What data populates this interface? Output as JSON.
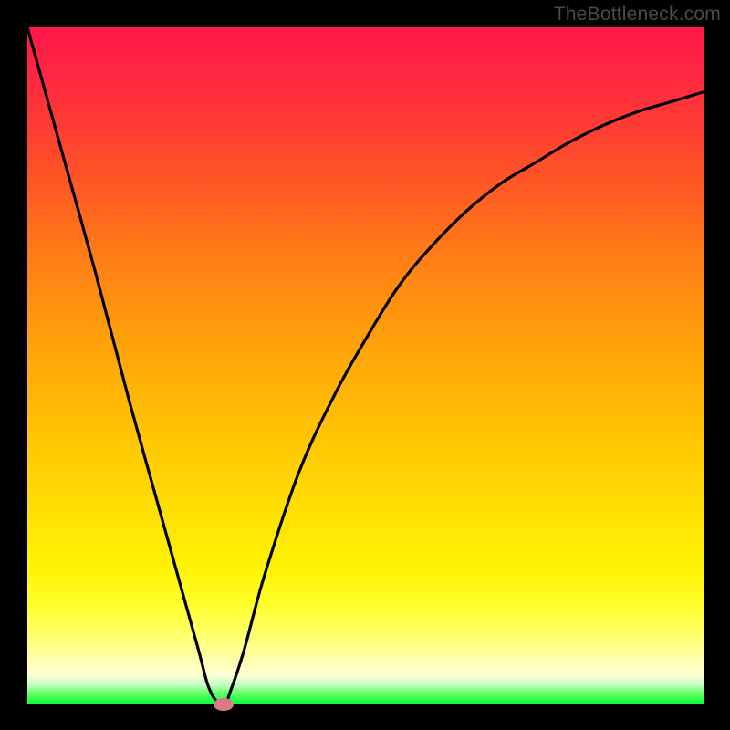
{
  "attribution": "TheBottleneck.com",
  "chart_data": {
    "type": "line",
    "title": "",
    "xlabel": "",
    "ylabel": "",
    "xlim": [
      0,
      100
    ],
    "ylim": [
      0,
      100
    ],
    "grid": false,
    "legend": false,
    "series": [
      {
        "name": "bottleneck-curve",
        "x": [
          0,
          5,
          10,
          15,
          20,
          25,
          27,
          29,
          30,
          32,
          35,
          40,
          45,
          50,
          55,
          60,
          65,
          70,
          75,
          80,
          85,
          90,
          95,
          100
        ],
        "y": [
          100,
          82,
          64,
          45,
          27,
          9,
          2,
          0,
          2,
          8,
          19,
          34,
          45,
          54,
          62,
          68,
          73,
          77,
          80,
          83,
          85.5,
          87.5,
          89,
          90.5
        ]
      }
    ],
    "marker": {
      "x": 29,
      "y": 0
    },
    "background_gradient": {
      "top_color": "#ff174a",
      "mid_color": "#ffff28",
      "bottom_color": "#00ff3a"
    }
  }
}
